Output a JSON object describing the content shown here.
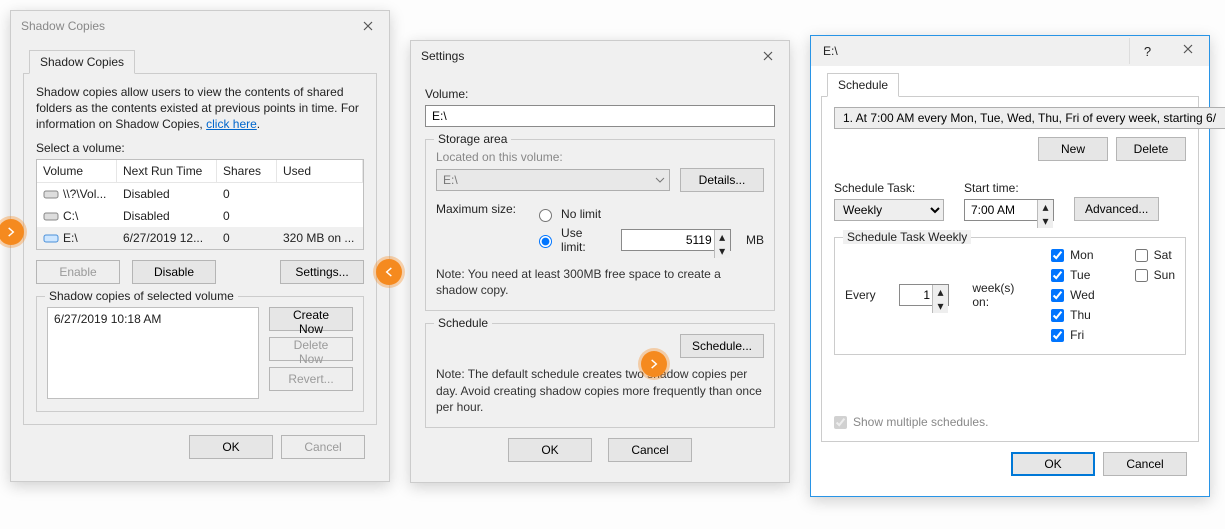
{
  "dialog1": {
    "title": "Shadow Copies",
    "tab": "Shadow Copies",
    "intro_1": "Shadow copies allow users to view the contents of shared folders as the contents existed at previous points in time. For information on Shadow Copies, ",
    "intro_link": "click here",
    "select_label": "Select a volume:",
    "headers": {
      "vol": "Volume",
      "nrt": "Next Run Time",
      "sh": "Shares",
      "used": "Used"
    },
    "rows": [
      {
        "vol": "\\\\?\\Vol...",
        "nrt": "Disabled",
        "sh": "0",
        "used": ""
      },
      {
        "vol": "C:\\",
        "nrt": "Disabled",
        "sh": "0",
        "used": ""
      },
      {
        "vol": "E:\\",
        "nrt": "6/27/2019 12...",
        "sh": "0",
        "used": "320 MB on ..."
      }
    ],
    "enable": "Enable",
    "disable": "Disable",
    "settings": "Settings...",
    "selected_group": "Shadow copies of selected volume",
    "snapshot": "6/27/2019 10:18 AM",
    "create": "Create Now",
    "delete": "Delete Now",
    "revert": "Revert...",
    "ok": "OK",
    "cancel": "Cancel"
  },
  "dialog2": {
    "title": "Settings",
    "volume_label": "Volume:",
    "volume_value": "E:\\",
    "storage_group": "Storage area",
    "located_label": "Located on this volume:",
    "located_value": "E:\\",
    "details": "Details...",
    "max_label": "Maximum size:",
    "nolimit": "No limit",
    "uselimit": "Use limit:",
    "size_value": "5119",
    "size_unit": "MB",
    "storage_note": "Note: You need at least 300MB free space to create a shadow copy.",
    "schedule_group": "Schedule",
    "schedule_btn": "Schedule...",
    "schedule_note": "Note: The default schedule creates two shadow copies per day. Avoid creating shadow copies more frequently than once per hour.",
    "ok": "OK",
    "cancel": "Cancel"
  },
  "dialog3": {
    "title": "E:\\",
    "tab": "Schedule",
    "summary": "1. At 7:00 AM every Mon, Tue, Wed, Thu, Fri of every week, starting 6/",
    "new": "New",
    "delete": "Delete",
    "task_label": "Schedule Task:",
    "task_value": "Weekly",
    "start_label": "Start time:",
    "start_value": "7:00 AM",
    "advanced": "Advanced...",
    "weekly_group": "Schedule Task Weekly",
    "every": "Every",
    "every_val": "1",
    "weeks_on": "week(s) on:",
    "days": {
      "mon": "Mon",
      "tue": "Tue",
      "wed": "Wed",
      "thu": "Thu",
      "fri": "Fri",
      "sat": "Sat",
      "sun": "Sun"
    },
    "multi": "Show multiple schedules.",
    "ok": "OK",
    "cancel": "Cancel"
  }
}
